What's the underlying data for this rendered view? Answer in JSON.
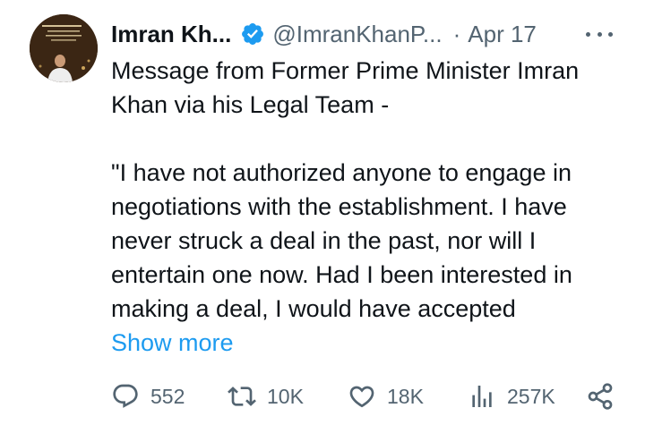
{
  "tweet": {
    "author": {
      "display_name": "Imran Kh...",
      "handle": "@ImranKhanP...",
      "verified": true,
      "verified_color": "#1d9bf0"
    },
    "separator": "·",
    "date": "Apr 17",
    "body": {
      "line1": "Message from Former Prime Minister Imran Khan via his Legal Team -",
      "line2": "\"I have not authorized anyone to engage in negotiations with the establishment. I have never struck a deal in the past, nor will I entertain one now. Had I been interested in making a deal, I would have accepted"
    },
    "show_more": "Show more",
    "metrics": {
      "replies": "552",
      "retweets": "10K",
      "likes": "18K",
      "views": "257K"
    },
    "colors": {
      "text": "#0f1419",
      "secondary": "#536471",
      "link": "#1d9bf0"
    }
  }
}
